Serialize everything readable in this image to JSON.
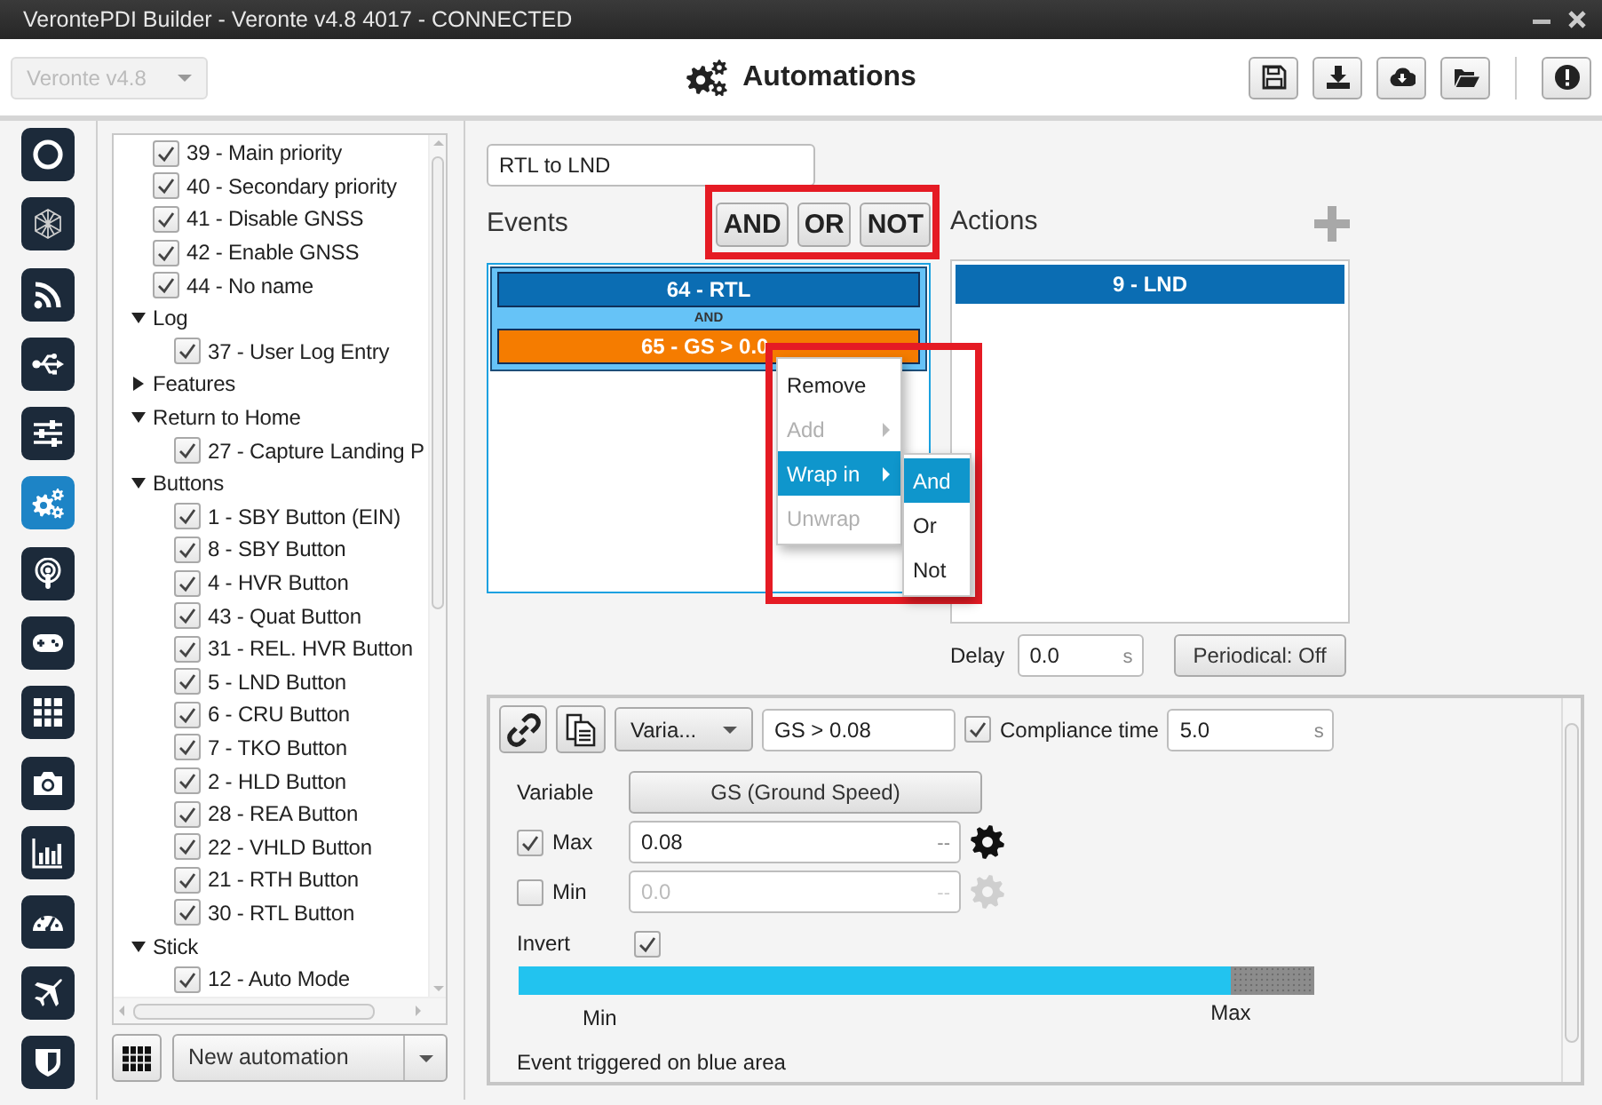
{
  "window": {
    "title": "VerontePDI Builder - Veronte v4.8 4017 - CONNECTED"
  },
  "device_select": {
    "value": "Veronte v4.8",
    "disabled": true
  },
  "header": {
    "title": "Automations"
  },
  "sidebar": {
    "items": [
      {
        "selected": false
      },
      {
        "selected": false
      },
      {
        "selected": false
      },
      {
        "selected": false
      },
      {
        "selected": false
      },
      {
        "selected": true
      },
      {
        "selected": false
      },
      {
        "selected": false
      },
      {
        "selected": false
      },
      {
        "selected": false
      },
      {
        "selected": false
      },
      {
        "selected": false
      },
      {
        "selected": false
      },
      {
        "selected": false
      }
    ]
  },
  "tree": {
    "items": [
      {
        "kind": "leaf",
        "label": "39 - Main priority",
        "checked": true
      },
      {
        "kind": "leaf",
        "label": "40 - Secondary priority",
        "checked": true
      },
      {
        "kind": "leaf",
        "label": "41 - Disable GNSS",
        "checked": true
      },
      {
        "kind": "leaf",
        "label": "42 - Enable GNSS",
        "checked": true
      },
      {
        "kind": "leaf",
        "label": "44 - No name",
        "checked": true
      },
      {
        "kind": "group",
        "label": "Log",
        "expanded": true,
        "children": [
          {
            "kind": "leaf",
            "label": "37 - User Log Entry",
            "checked": true
          }
        ]
      },
      {
        "kind": "group",
        "label": "Features",
        "expanded": false
      },
      {
        "kind": "group",
        "label": "Return to Home",
        "expanded": true,
        "children": [
          {
            "kind": "leaf",
            "label": "27 - Capture Landing P",
            "checked": true
          }
        ]
      },
      {
        "kind": "group",
        "label": "Buttons",
        "expanded": true,
        "children": [
          {
            "kind": "leaf",
            "label": "1 - SBY Button (EIN)",
            "checked": true
          },
          {
            "kind": "leaf",
            "label": "8 - SBY Button",
            "checked": true
          },
          {
            "kind": "leaf",
            "label": "4 - HVR Button",
            "checked": true
          },
          {
            "kind": "leaf",
            "label": "43 - Quat Button",
            "checked": true
          },
          {
            "kind": "leaf",
            "label": "31 - REL. HVR Button",
            "checked": true
          },
          {
            "kind": "leaf",
            "label": "5 - LND Button",
            "checked": true
          },
          {
            "kind": "leaf",
            "label": "6 - CRU Button",
            "checked": true
          },
          {
            "kind": "leaf",
            "label": "7 - TKO Button",
            "checked": true
          },
          {
            "kind": "leaf",
            "label": "2 - HLD Button",
            "checked": true
          },
          {
            "kind": "leaf",
            "label": "28 - REA Button",
            "checked": true
          },
          {
            "kind": "leaf",
            "label": "22 - VHLD Button",
            "checked": true
          },
          {
            "kind": "leaf",
            "label": "21 - RTH Button",
            "checked": true
          },
          {
            "kind": "leaf",
            "label": "30 - RTL Button",
            "checked": true
          }
        ]
      },
      {
        "kind": "group",
        "label": "Stick",
        "expanded": true,
        "children": [
          {
            "kind": "leaf",
            "label": "12 - Auto Mode",
            "checked": true
          }
        ]
      }
    ]
  },
  "new_automation": {
    "label": "New automation"
  },
  "automation": {
    "name": "RTL to LND",
    "events_label": "Events",
    "logic_buttons": {
      "highlighted": true,
      "items": [
        "AND",
        "OR",
        "NOT"
      ]
    },
    "actions_label": "Actions",
    "events": {
      "operator": "AND",
      "items": [
        {
          "kind": "state",
          "label": "64 - RTL"
        },
        {
          "kind": "variable",
          "label": "65 - GS > 0.0"
        }
      ]
    },
    "actions": [
      {
        "label": "9 - LND",
        "selected": true
      }
    ],
    "delay": {
      "label": "Delay",
      "value": "0.0",
      "unit": "s"
    },
    "periodical": "Periodical: Off"
  },
  "context_menu": {
    "highlighted": true,
    "items": [
      {
        "label": "Remove",
        "disabled": false,
        "submenu": false,
        "selected": false
      },
      {
        "label": "Add",
        "disabled": true,
        "submenu": true,
        "selected": false
      },
      {
        "label": "Wrap in",
        "disabled": false,
        "submenu": true,
        "selected": true
      },
      {
        "label": "Unwrap",
        "disabled": true,
        "submenu": false,
        "selected": false
      }
    ],
    "submenu": [
      {
        "label": "And",
        "selected": true
      },
      {
        "label": "Or",
        "selected": false
      },
      {
        "label": "Not",
        "selected": false
      }
    ]
  },
  "editor": {
    "type_select": "Varia...",
    "condition": "GS > 0.08",
    "compliance": {
      "checked": true,
      "label": "Compliance time",
      "value": "5.0",
      "unit": "s"
    },
    "variable": {
      "label": "Variable",
      "value": "GS (Ground Speed)"
    },
    "max": {
      "checked": true,
      "label": "Max",
      "value": "0.08",
      "unit": "--"
    },
    "min": {
      "checked": false,
      "label": "Min",
      "value": "0.0",
      "unit": "--"
    },
    "invert": {
      "label": "Invert",
      "checked": true
    },
    "range": {
      "level": 0.895,
      "min_label": "Min",
      "max_label": "Max"
    },
    "note": "Event triggered on blue area"
  }
}
